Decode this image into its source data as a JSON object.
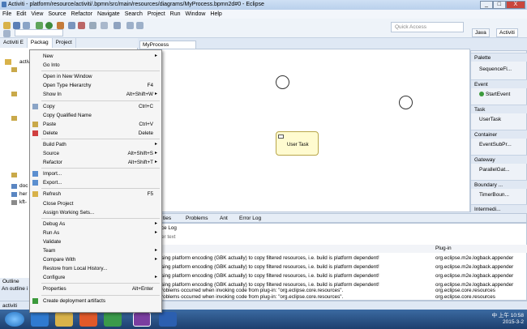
{
  "window": {
    "title": "Activiti - platform/resource/activiti/.bpmn/src/main/resources/diagrams/MyProcess.bpmn2d#0 - Eclipse",
    "buttons": [
      "_",
      "□",
      "X"
    ]
  },
  "menubar": [
    "File",
    "Edit",
    "View",
    "Source",
    "Refactor",
    "Navigate",
    "Search",
    "Project",
    "Run",
    "Window",
    "Help"
  ],
  "toolbar": {
    "quick_access": "Quick Access",
    "perspectives": [
      "Java",
      "Activiti"
    ]
  },
  "left": {
    "tabs": [
      "Activiti E",
      "Packag",
      "Project"
    ],
    "tree_items": [
      "activi",
      "doc",
      "her",
      "kft-"
    ],
    "outline_tab": "Outline",
    "outline_text": "An outline i"
  },
  "editor": {
    "tab": "MyProcess",
    "task_label": "User Task"
  },
  "palette": {
    "title": "Palette",
    "items": [
      {
        "label": "SequenceFl...",
        "kind": "sub"
      },
      {
        "label": "Event",
        "kind": "hdr"
      },
      {
        "label": "StartEvent",
        "kind": "sub"
      },
      {
        "label": "Task",
        "kind": "hdr"
      },
      {
        "label": "UserTask",
        "kind": "sub"
      },
      {
        "label": "Container",
        "kind": "hdr"
      },
      {
        "label": "EventSubPr...",
        "kind": "sub"
      },
      {
        "label": "Gateway",
        "kind": "hdr"
      },
      {
        "label": "ParallelGat...",
        "kind": "sub"
      },
      {
        "label": "Boundary ...",
        "kind": "hdr"
      },
      {
        "label": "TimerBoun...",
        "kind": "sub"
      },
      {
        "label": "Intermedi...",
        "kind": "hdr"
      }
    ]
  },
  "bottom": {
    "tabs": [
      "ties",
      "Problems",
      "Ant",
      "Error Log"
    ],
    "subtitle": "ce Log",
    "filter": "er text",
    "col_plugin": "Plug-in",
    "rows": [
      {
        "msg": "sing platform encoding (GBK actually) to copy filtered resources, i.e. build is platform dependent!",
        "plug": "org.eclipse.m2e.logback.appender"
      },
      {
        "msg": "sing platform encoding (GBK actually) to copy filtered resources, i.e. build is platform dependent!",
        "plug": "org.eclipse.m2e.logback.appender"
      },
      {
        "msg": "sing platform encoding (GBK actually) to copy filtered resources, i.e. build is platform dependent!",
        "plug": "org.eclipse.m2e.logback.appender"
      },
      {
        "msg": "sing platform encoding (GBK actually) to copy filtered resources, i.e. build is platform dependent!",
        "plug": "org.eclipse.m2e.logback.appender"
      },
      {
        "msg": "roblems occurred when invoking code from plug-in: \"org.eclipse.core.resources\".",
        "plug": "org.eclipse.core.resources"
      },
      {
        "msg": "roblems occurred when invoking code from plug-in: \"org.eclipse.core.resources\".",
        "plug": "org.eclipse.core.resources"
      }
    ]
  },
  "status": "activiti",
  "tray": {
    "lang": "中",
    "time": "10:58",
    "date": "2015-3-2",
    "ampm": "上午"
  },
  "context_menu": [
    {
      "label": "New",
      "arrow": true
    },
    {
      "label": "Go Into"
    },
    {
      "sep": true
    },
    {
      "label": "Open in New Window"
    },
    {
      "label": "Open Type Hierarchy",
      "shortcut": "F4"
    },
    {
      "label": "Show In",
      "shortcut": "Alt+Shift+W",
      "arrow": true
    },
    {
      "sep": true
    },
    {
      "label": "Copy",
      "shortcut": "Ctrl+C",
      "icon": "copy-icon"
    },
    {
      "label": "Copy Qualified Name"
    },
    {
      "label": "Paste",
      "shortcut": "Ctrl+V",
      "icon": "paste-icon"
    },
    {
      "label": "Delete",
      "shortcut": "Delete",
      "icon": "delete-icon"
    },
    {
      "sep": true
    },
    {
      "label": "Build Path",
      "arrow": true
    },
    {
      "label": "Source",
      "shortcut": "Alt+Shift+S",
      "arrow": true
    },
    {
      "label": "Refactor",
      "shortcut": "Alt+Shift+T",
      "arrow": true
    },
    {
      "sep": true
    },
    {
      "label": "Import...",
      "icon": "import-icon"
    },
    {
      "label": "Export...",
      "icon": "export-icon"
    },
    {
      "sep": true
    },
    {
      "label": "Refresh",
      "shortcut": "F5",
      "icon": "refresh-icon"
    },
    {
      "label": "Close Project"
    },
    {
      "label": "Assign Working Sets..."
    },
    {
      "sep": true
    },
    {
      "label": "Debug As",
      "arrow": true
    },
    {
      "label": "Run As",
      "arrow": true
    },
    {
      "label": "Validate"
    },
    {
      "label": "Team",
      "arrow": true
    },
    {
      "label": "Compare With",
      "arrow": true
    },
    {
      "label": "Restore from Local History..."
    },
    {
      "label": "Configure",
      "arrow": true
    },
    {
      "sep": true
    },
    {
      "label": "Properties",
      "shortcut": "Alt+Enter"
    },
    {
      "sep": true
    },
    {
      "label": "Create deployment artifacts",
      "icon": "deploy-icon"
    }
  ],
  "colors": {
    "accent": "#3b6aa1",
    "task_fill": "#fffbd0",
    "close": "#c9463d"
  }
}
